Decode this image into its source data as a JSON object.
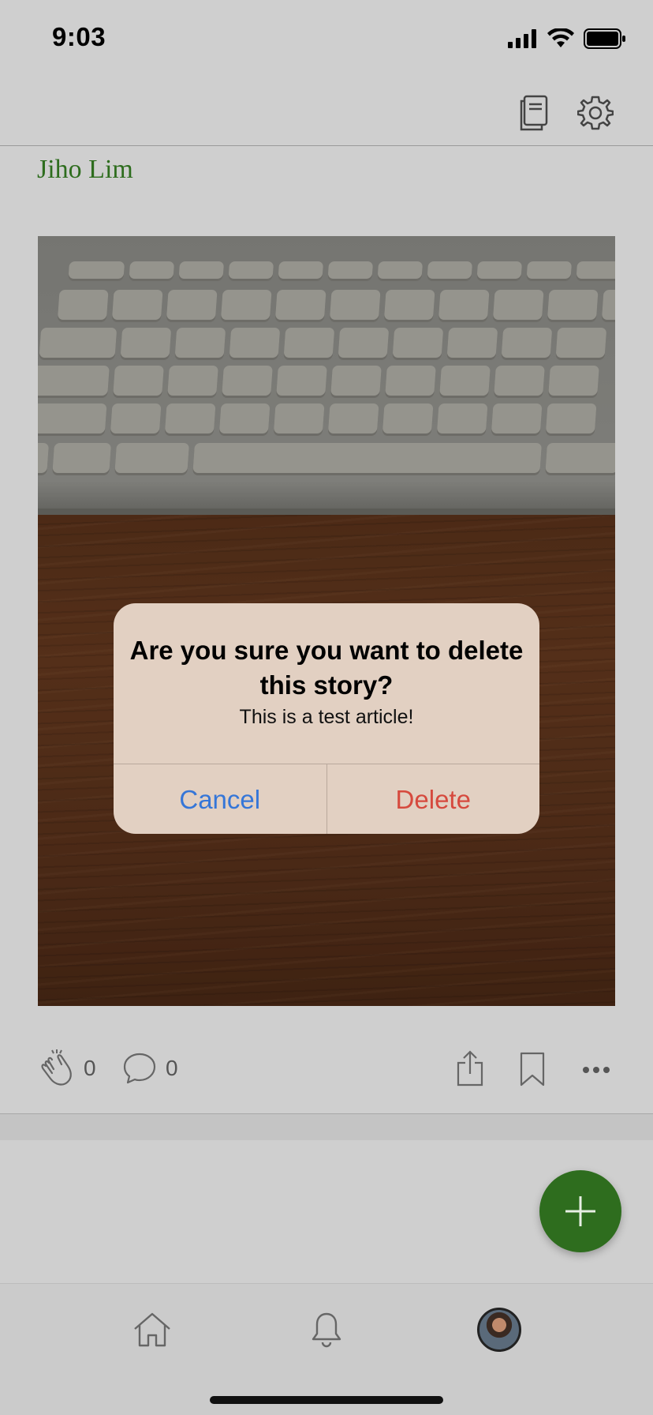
{
  "status_bar": {
    "time": "9:03",
    "icons": [
      "signal-icon",
      "wifi-icon",
      "battery-icon"
    ]
  },
  "top_nav": {
    "icons": [
      "reading-list-icon",
      "settings-gear-icon"
    ]
  },
  "post": {
    "author": "Jiho Lim",
    "claps": "0",
    "comments": "0",
    "actions": [
      "share-icon",
      "bookmark-icon",
      "more-icon"
    ]
  },
  "alert": {
    "title": "Are you sure you want to delete this story?",
    "message": "This is a test article!",
    "cancel_label": "Cancel",
    "delete_label": "Delete"
  },
  "tab_bar": {
    "items": [
      "home-icon",
      "notifications-bell-icon",
      "profile-avatar"
    ]
  },
  "colors": {
    "accent_green": "#2e6d1e",
    "cancel_blue": "#3576d8",
    "delete_red": "#d64a3e"
  }
}
